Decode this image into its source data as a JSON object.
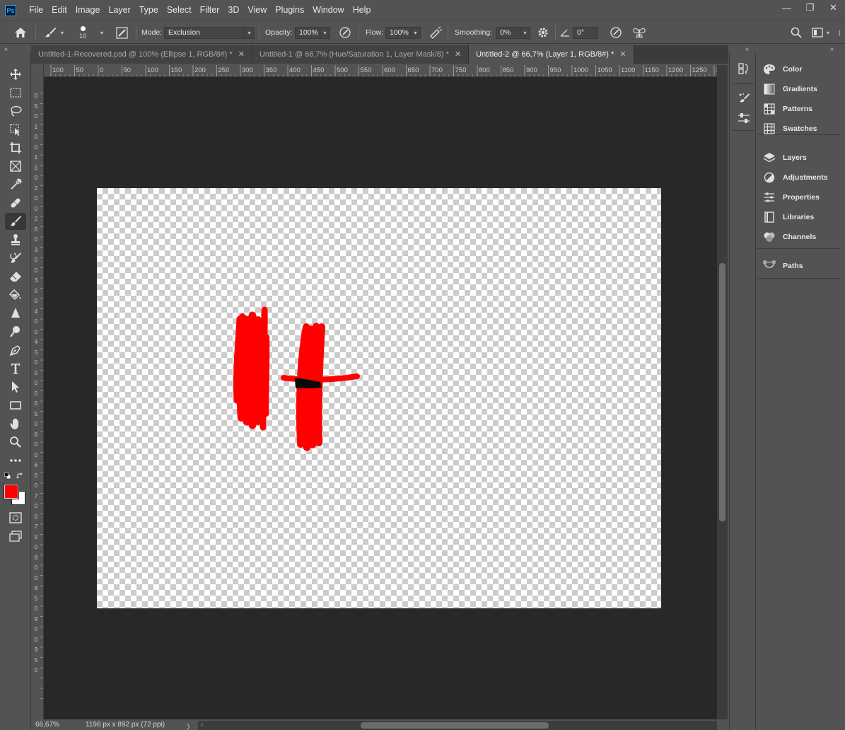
{
  "menu": [
    "File",
    "Edit",
    "Image",
    "Layer",
    "Type",
    "Select",
    "Filter",
    "3D",
    "View",
    "Plugins",
    "Window",
    "Help"
  ],
  "window_controls": {
    "minimize": "—",
    "restore": "❐",
    "close": "✕"
  },
  "options": {
    "brush_size": "10",
    "mode_label": "Mode:",
    "mode_value": "Exclusion",
    "opacity_label": "Opacity:",
    "opacity_value": "100%",
    "flow_label": "Flow:",
    "flow_value": "100%",
    "smoothing_label": "Smoothing:",
    "smoothing_value": "0%",
    "angle_value": "0°"
  },
  "tabs": [
    {
      "label": "Untitled-1-Recovered.psd @ 100% (Ellipse 1, RGB/8#) *",
      "active": false
    },
    {
      "label": "Untitled-1 @ 66,7% (Hue/Saturation 1, Layer Mask/8) *",
      "active": false
    },
    {
      "label": "Untitled-2 @ 66,7% (Layer 1, RGB/8#) *",
      "active": true
    }
  ],
  "ruler_top_labels": [
    "100",
    "50",
    "0",
    "50",
    "100",
    "150",
    "200",
    "250",
    "300",
    "350",
    "400",
    "450",
    "500",
    "550",
    "600",
    "650",
    "700",
    "750",
    "800",
    "850",
    "900",
    "950",
    "1000",
    "1050",
    "1100",
    "1150",
    "1200",
    "1250",
    "13"
  ],
  "ruler_left_labels": [
    "0",
    "5",
    "0",
    "1",
    "0",
    "0",
    "1",
    "5",
    "0",
    "2",
    "0",
    "0",
    "2",
    "5",
    "0",
    "3",
    "0",
    "0",
    "3",
    "5",
    "0",
    "4",
    "0",
    "0",
    "4",
    "5",
    "0",
    "5",
    "0",
    "0",
    "5",
    "5",
    "0",
    "6",
    "0",
    "0",
    "6",
    "5",
    "0",
    "7",
    "0",
    "0",
    "7",
    "5",
    "0",
    "8",
    "0",
    "0",
    "8",
    "5",
    "0",
    "9",
    "0",
    "0",
    "9",
    "5",
    "0"
  ],
  "status": {
    "zoom": "66,67%",
    "doc_info": "1196 px x 892 px (72 ppi)",
    "arrow": "〉"
  },
  "colors": {
    "foreground": "#ff0000",
    "background": "#ffffff",
    "stroke_red": "#ff0000",
    "stroke_dark": "#0a0a0a"
  },
  "panels": {
    "group1": [
      "Color",
      "Gradients",
      "Patterns",
      "Swatches"
    ],
    "group2": [
      "Layers",
      "Adjustments",
      "Properties",
      "Libraries",
      "Channels"
    ],
    "group3": [
      "Paths"
    ]
  }
}
